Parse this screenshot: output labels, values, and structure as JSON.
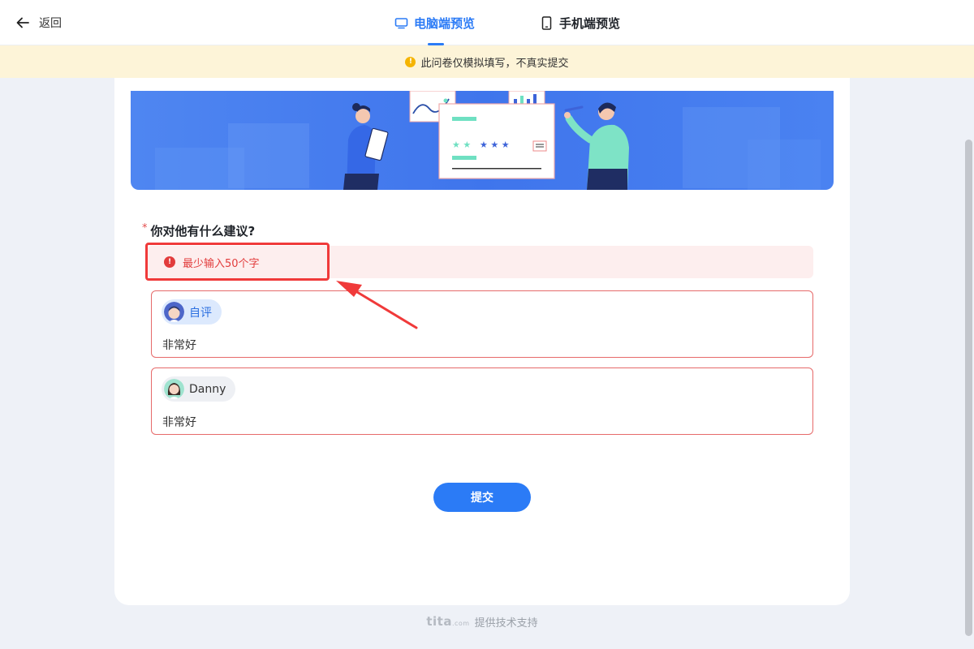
{
  "header": {
    "back_label": "返回",
    "tabs": [
      {
        "label": "电脑端预览",
        "active": true
      },
      {
        "label": "手机端预览",
        "active": false
      }
    ]
  },
  "notice": {
    "text": "此问卷仅模拟填写，不真实提交",
    "icon": "info-icon",
    "icon_color": "#f5b400"
  },
  "question": {
    "required_mark": "*",
    "title": "你对他有什么建议?",
    "error": "最少输入50个字",
    "answers": [
      {
        "author": "自评",
        "text": "非常好"
      },
      {
        "author": "Danny",
        "text": "非常好"
      }
    ]
  },
  "submit_label": "提交",
  "footer": {
    "logo": "tita",
    "logo_suffix": ".com",
    "text": "提供技术支持"
  },
  "colors": {
    "accent": "#2b7bf6",
    "error": "#e23c3c",
    "annotation": "#f03a3a"
  }
}
